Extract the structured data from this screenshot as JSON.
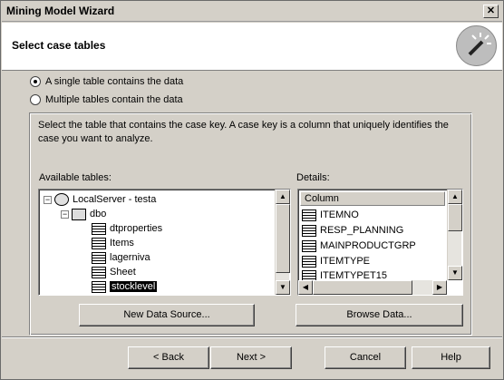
{
  "window": {
    "title": "Mining Model Wizard",
    "close_label": "✕"
  },
  "header": {
    "title": "Select case tables",
    "icon": "wizard-wand-icon"
  },
  "options": {
    "single": "A single table contains the data",
    "multiple": "Multiple tables contain the data",
    "selected": "single"
  },
  "instructions": "Select the table that contains the case key. A case key is a column that uniquely identifies the case you want to analyze.",
  "available_label": "Available tables:",
  "details_label": "Details:",
  "tree": {
    "server": "LocalServer - testa",
    "schema": "dbo",
    "tables": [
      "dtproperties",
      "Items",
      "lagerniva",
      "Sheet",
      "stocklevel"
    ],
    "selected": "stocklevel"
  },
  "details": {
    "column_header": "Column",
    "columns": [
      "ITEMNO",
      "RESP_PLANNING",
      "MAINPRODUCTGRP",
      "ITEMTYPE",
      "ITEMTYPET15"
    ]
  },
  "buttons": {
    "new_source": "New Data Source...",
    "browse": "Browse Data...",
    "back": "< Back",
    "next": "Next >",
    "cancel": "Cancel",
    "help": "Help"
  }
}
